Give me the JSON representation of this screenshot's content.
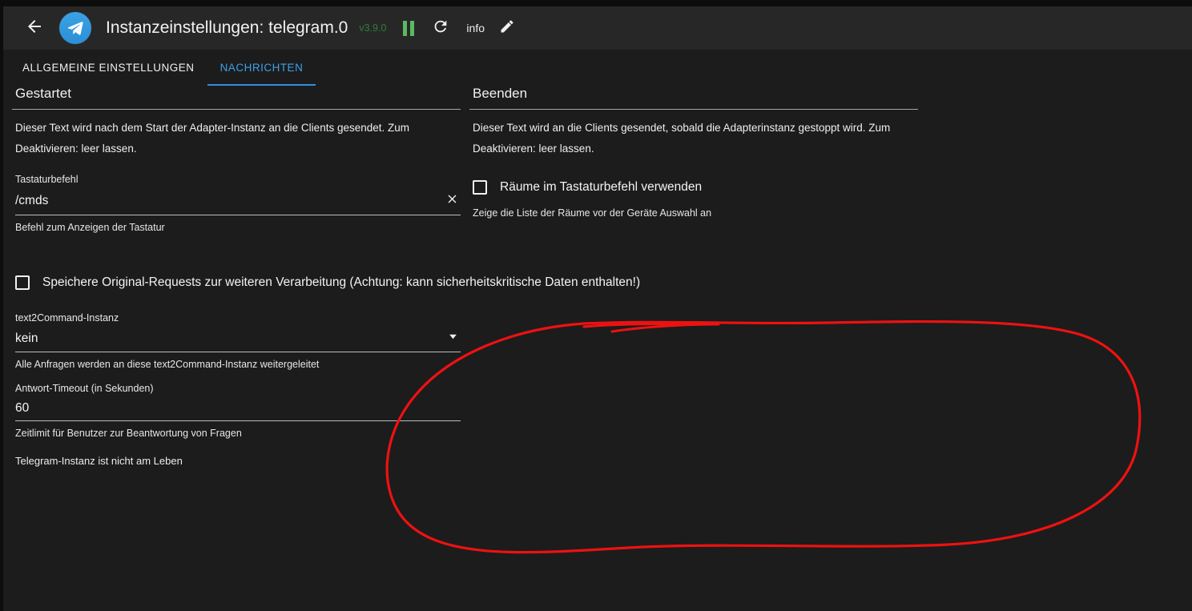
{
  "window": {
    "background_color": "#1c1c1c",
    "header_background_color": "#272727"
  },
  "header": {
    "back_icon": "arrow-left-icon",
    "logo_icon": "telegram-logo-icon",
    "title": "Instanzeinstellungen: telegram.0",
    "version": "v3.9.0",
    "version_color": "#2f7d3a",
    "pause_icon": "pause-icon",
    "pause_color": "#5cb860",
    "refresh_icon": "refresh-icon",
    "info_label": "info",
    "edit_icon": "pencil-icon"
  },
  "tabs": [
    {
      "label": "ALLGEMEINE EINSTELLUNGEN",
      "active": false
    },
    {
      "label": "NACHRICHTEN",
      "active": true
    }
  ],
  "tab_active_color": "#3ba0e8",
  "sections": {
    "started": {
      "title": "Gestartet",
      "description": "Dieser Text wird nach dem Start der Adapter-Instanz an die Clients gesendet. Zum Deaktivieren: leer lassen.",
      "keyboard_command": {
        "label": "Tastaturbefehl",
        "value": "/cmds",
        "placeholder": "",
        "clear_icon": "close-icon",
        "help": "Befehl zum Anzeigen der Tastatur"
      }
    },
    "stopped": {
      "title": "Beenden",
      "description": "Dieser Text wird an die Clients gesendet, sobald die Adapterinstanz gestoppt wird. Zum Deaktivieren: leer lassen.",
      "rooms_checkbox": {
        "label": "Räume im Tastaturbefehl verwenden",
        "checked": false,
        "help": "Zeige die Liste der Räume vor der Geräte Auswahl an"
      }
    }
  },
  "store_requests_checkbox": {
    "label": "Speichere Original-Requests zur weiteren Verarbeitung (Achtung: kann sicherheitskritische Daten enthalten!)",
    "checked": false
  },
  "text2command": {
    "label": "text2Command-Instanz",
    "value": "kein",
    "caret_icon": "chevron-down-icon",
    "help": "Alle Anfragen werden an diese text2Command-Instanz weitergeleitet"
  },
  "answer_timeout": {
    "label": "Antwort-Timeout (in Sekunden)",
    "value": "60",
    "help": "Zeitlimit für Benutzer zur Beantwortung von Fragen"
  },
  "status": {
    "text": "Telegram-Instanz ist nicht am Leben"
  },
  "annotation": {
    "type": "hand-drawn-ellipse",
    "color": "#ee1111",
    "stroke_width": 3
  }
}
